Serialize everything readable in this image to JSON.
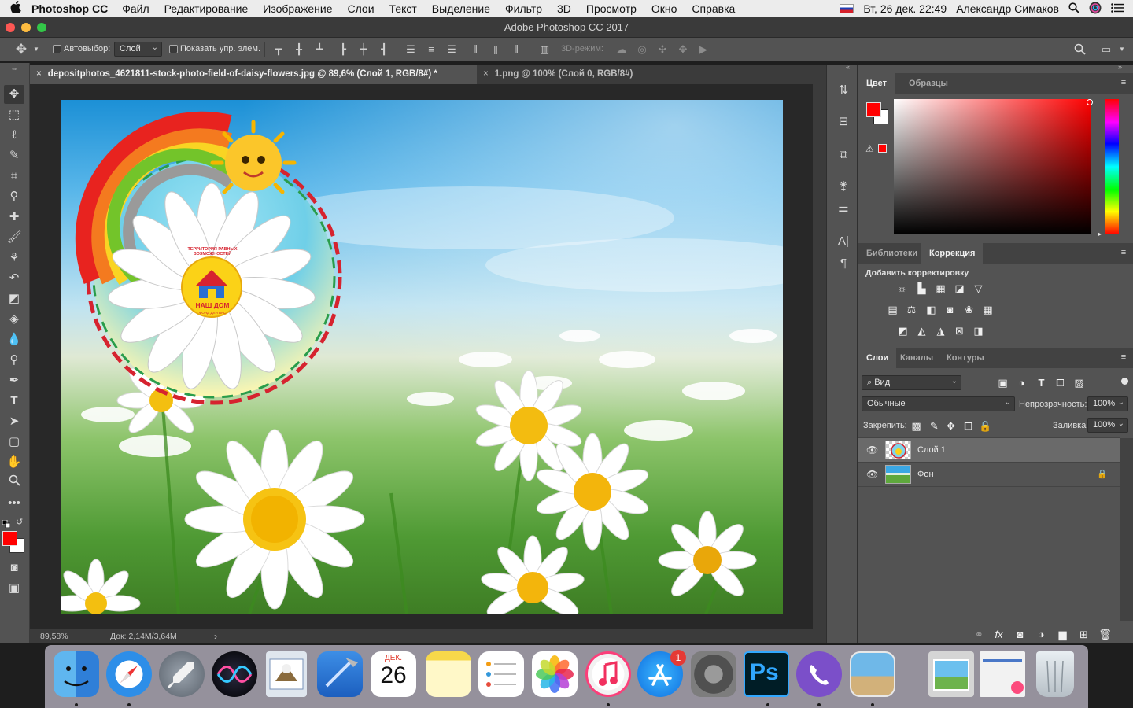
{
  "menubar": {
    "apple": "",
    "app_name": "Photoshop CC",
    "menus": [
      "Файл",
      "Редактирование",
      "Изображение",
      "Слои",
      "Текст",
      "Выделение",
      "Фильтр",
      "3D",
      "Просмотр",
      "Окно",
      "Справка"
    ],
    "datetime": "Вт, 26 дек.  22:49",
    "user": "Александр Симаков",
    "icons": [
      "flag-ru-icon",
      "search-icon",
      "siri-icon",
      "list-icon"
    ]
  },
  "window": {
    "title": "Adobe Photoshop CC 2017",
    "traffic_colors": [
      "#fc5753",
      "#fdbc40",
      "#33c748"
    ]
  },
  "options_bar": {
    "autoselect_label": "Автовыбор:",
    "autoselect_value": "Слой",
    "show_controls_label": "Показать упр. элем.",
    "mode_3d_label": "3D-режим:"
  },
  "tabs": [
    {
      "label": "depositphotos_4621811-stock-photo-field-of-daisy-flowers.jpg @ 89,6% (Слой 1, RGB/8#) *",
      "active": true
    },
    {
      "label": "1.png @ 100% (Слой 0, RGB/8#)",
      "active": false
    }
  ],
  "status": {
    "zoom": "89,58%",
    "doc": "Док: 2,14М/3,64М"
  },
  "color_panel": {
    "tabs": [
      "Цвет",
      "Образцы"
    ],
    "foreground": "#ff0000",
    "background": "#ffffff"
  },
  "adjust_panel": {
    "tabs": [
      "Библиотеки",
      "Коррекция"
    ],
    "add_label": "Добавить корректировку"
  },
  "layers_panel": {
    "tabs": [
      "Слои",
      "Каналы",
      "Контуры"
    ],
    "filter_value": "Вид",
    "blend_mode": "Обычные",
    "opacity_label": "Непрозрачность:",
    "opacity_value": "100%",
    "lock_label": "Закрепить:",
    "fill_label": "Заливка:",
    "fill_value": "100%",
    "layers": [
      {
        "name": "Слой 1",
        "selected": true
      },
      {
        "name": "Фон",
        "selected": false,
        "locked": true
      }
    ]
  },
  "artwork": {
    "logo_lines": [
      "ТЕРРИТОРИЯ РАВНЫХ ВОЗМОЖНОСТЕЙ",
      "НАШ ДОМ",
      "ФОНД ДЛЯ ВАС"
    ]
  },
  "dock": {
    "calendar_month": "ДЕК.",
    "calendar_day": "26",
    "appstore_badge": "1",
    "apps": [
      "finder",
      "safari",
      "launchpad",
      "siri",
      "mail",
      "xcode",
      "calendar",
      "notes",
      "reminders",
      "photos",
      "itunes",
      "app-store",
      "system-preferences",
      "photoshop",
      "viber",
      "preview",
      "folder",
      "documents",
      "trash"
    ]
  }
}
